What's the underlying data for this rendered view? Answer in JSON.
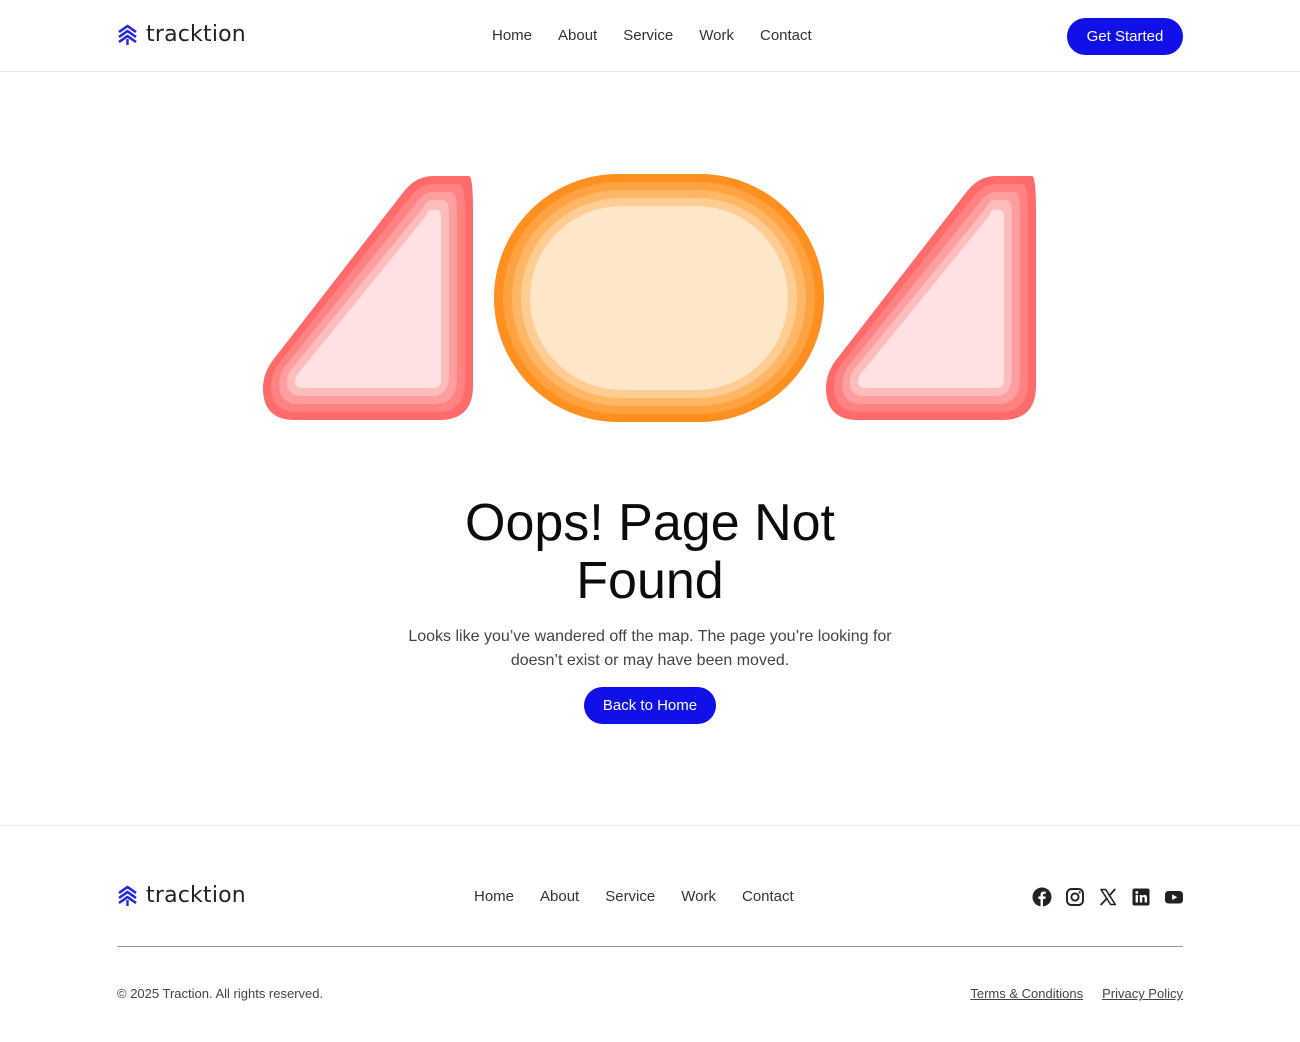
{
  "brand": {
    "name": "tracktion",
    "accent": "#1010e8"
  },
  "header": {
    "nav": [
      "Home",
      "About",
      "Service",
      "Work",
      "Contact"
    ],
    "cta_label": "Get Started"
  },
  "hero": {
    "art_digits": "404",
    "art_colors": {
      "four": "#ff6b6b",
      "zero": "#ff9a2e"
    },
    "title_line1": "Oops! Page Not",
    "title_line2": "Found",
    "subtitle_line1": "Looks like you’ve wandered off the map. The page you’re looking for",
    "subtitle_line2": "doesn’t exist or may have been moved.",
    "button_label": "Back to Home"
  },
  "footer": {
    "nav": [
      "Home",
      "About",
      "Service",
      "Work",
      "Contact"
    ],
    "social": [
      "facebook-icon",
      "instagram-icon",
      "x-icon",
      "linkedin-icon",
      "youtube-icon"
    ],
    "copyright": "© 2025 Traction. All rights reserved.",
    "legal": [
      "Terms & Conditions",
      "Privacy Policy"
    ]
  }
}
